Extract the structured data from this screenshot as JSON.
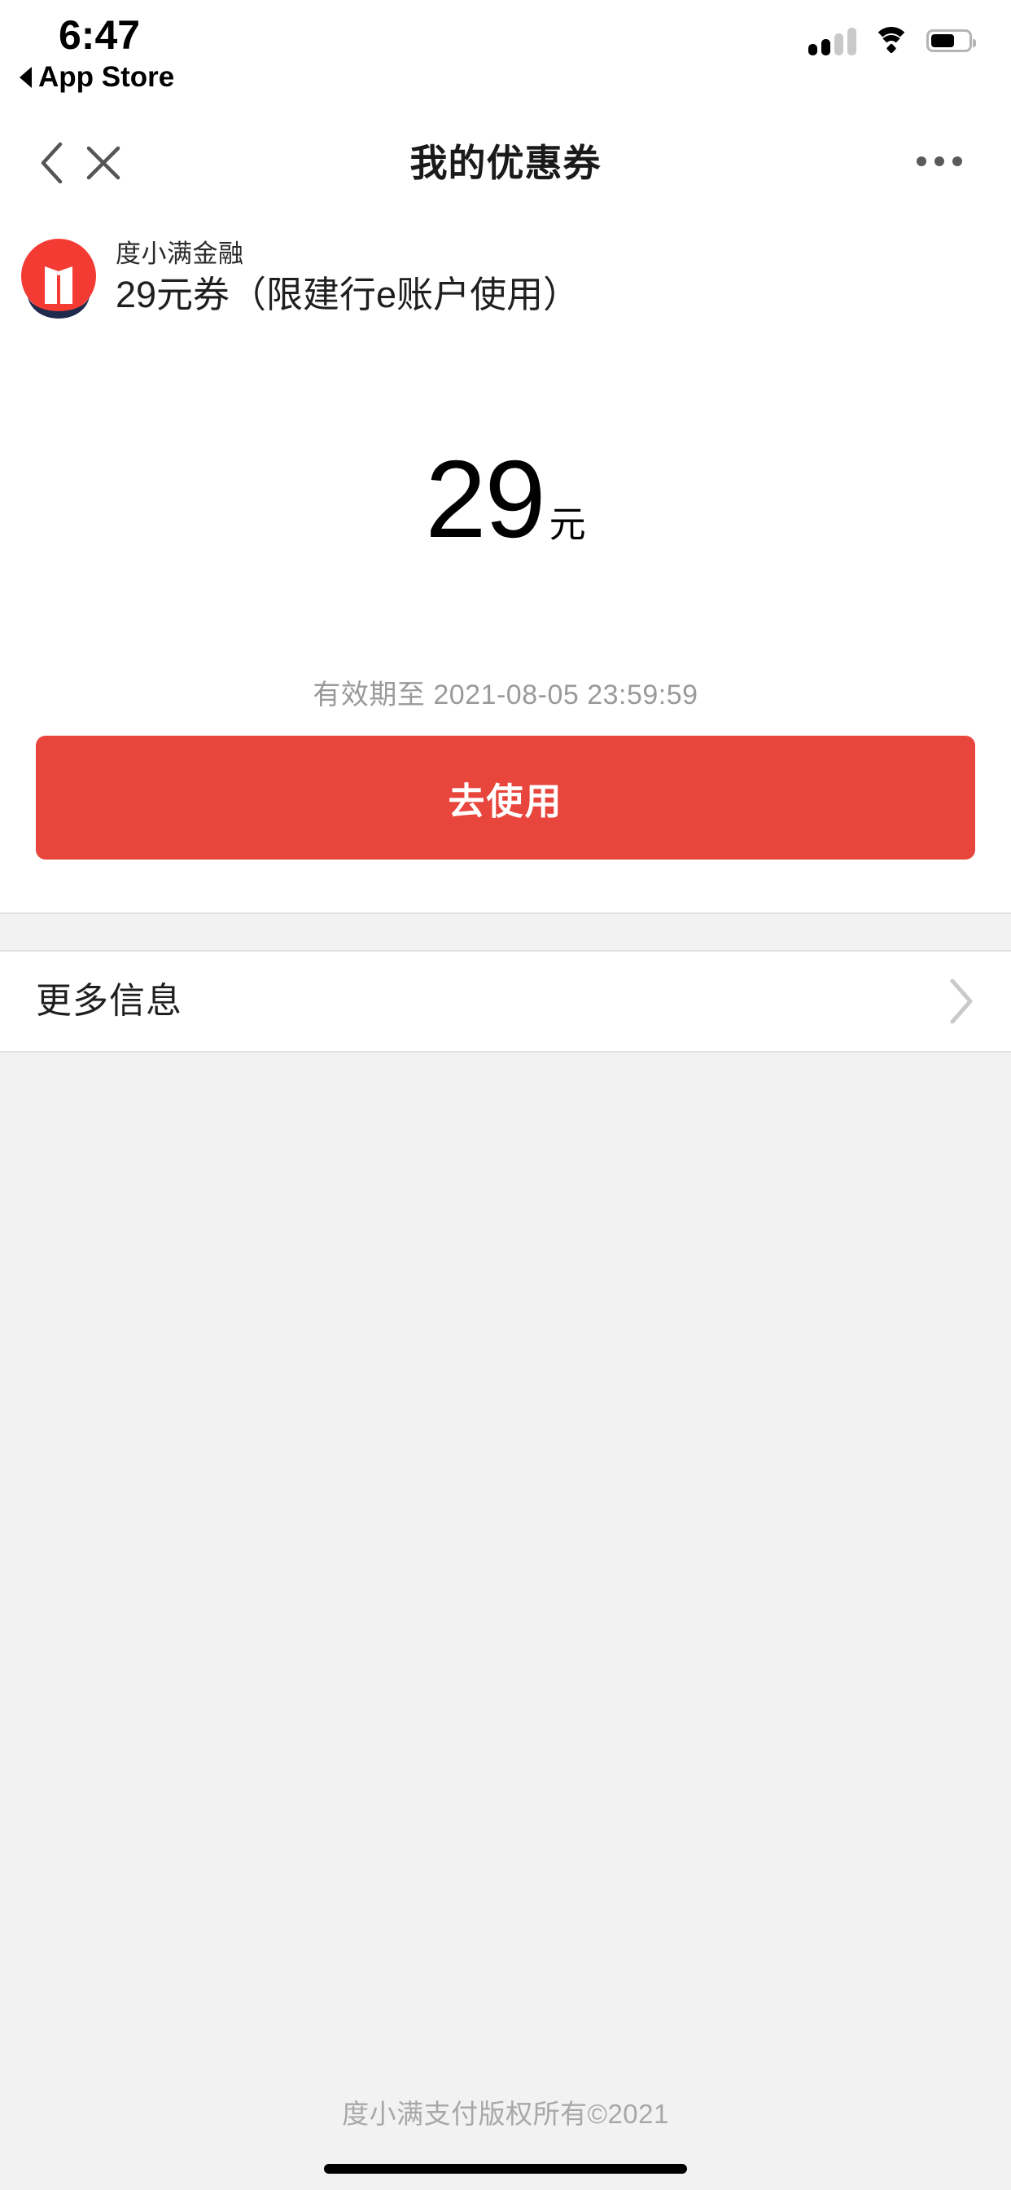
{
  "status_bar": {
    "time": "6:47",
    "back_app_label": "App Store",
    "back_triangle_icon": "triangle-left-icon",
    "signal_icon": "cellular-signal-icon",
    "wifi_icon": "wifi-icon",
    "battery_icon": "battery-icon",
    "battery_level_percent": 56
  },
  "nav_bar": {
    "back_icon": "chevron-left-icon",
    "close_icon": "close-x-icon",
    "title": "我的优惠券",
    "more_icon": "ellipsis-icon"
  },
  "coupon": {
    "logo_icon": "duxiaoman-book-logo-icon",
    "brand_name": "度小满金融",
    "title": "29元券（限建行e账户使用）",
    "amount": "29",
    "amount_unit": "元",
    "validity_text": "有效期至 2021-08-05 23:59:59",
    "action_button_label": "去使用"
  },
  "more_info": {
    "label": "更多信息",
    "chevron_icon": "chevron-right-icon"
  },
  "footer": {
    "copyright": "度小满支付版权所有©2021"
  },
  "colors": {
    "brand_red": "#f33b33",
    "button_red": "#e8453c",
    "page_background": "#f2f2f2",
    "logo_navy": "#1f2a4d"
  }
}
